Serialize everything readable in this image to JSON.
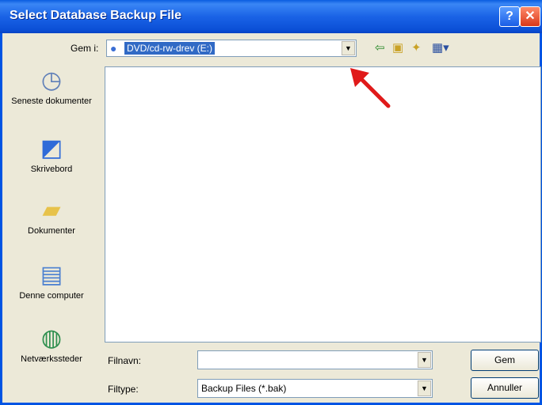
{
  "window": {
    "title": "Select Database Backup File",
    "help_label": "?",
    "close_label": "✕"
  },
  "lookin": {
    "label": "Gem i:",
    "value": "DVD/cd-rw-drev (E:)"
  },
  "toolbar": {
    "icons": [
      "back-icon",
      "up-folder-icon",
      "new-folder-icon",
      "view-menu-icon"
    ]
  },
  "places": [
    {
      "label": "Seneste dokumenter",
      "icon": "recent-documents-icon"
    },
    {
      "label": "Skrivebord",
      "icon": "desktop-icon"
    },
    {
      "label": "Dokumenter",
      "icon": "documents-folder-icon"
    },
    {
      "label": "Denne computer",
      "icon": "my-computer-icon"
    },
    {
      "label": "Netværkssteder",
      "icon": "network-places-icon"
    }
  ],
  "filename": {
    "label": "Filnavn:",
    "value": ""
  },
  "filetype": {
    "label": "Filtype:",
    "value": "Backup Files (*.bak)"
  },
  "buttons": {
    "save": "Gem",
    "cancel": "Annuller"
  },
  "colors": {
    "titlebar": "#0a5de0",
    "selection": "#316ac5",
    "annotation_arrow": "#e01a1a"
  }
}
